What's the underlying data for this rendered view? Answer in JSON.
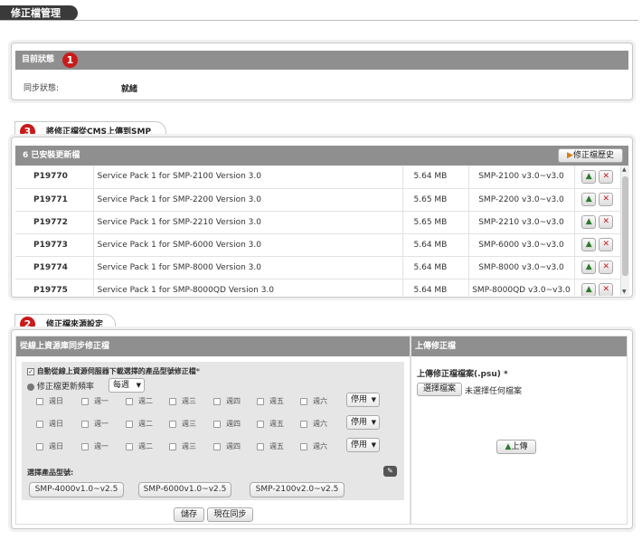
{
  "page": {
    "title": "修正檔管理"
  },
  "status_panel": {
    "header": "目前狀態",
    "badge": "1",
    "sync_label": "同步狀態:",
    "sync_value": "就緒"
  },
  "upload_panel": {
    "tab_badge": "3",
    "tab_label": "將修正檔從CMS上傳到SMP",
    "header": "6 已安裝更新檔",
    "history_button": "修正檔歷史",
    "rows": [
      {
        "id": "P19770",
        "desc": "Service Pack 1 for SMP-2100 Version 3.0",
        "size": "5.64 MB",
        "range": "SMP-2100 v3.0~v3.0"
      },
      {
        "id": "P19771",
        "desc": "Service Pack 1 for SMP-2200 Version 3.0",
        "size": "5.65 MB",
        "range": "SMP-2200 v3.0~v3.0"
      },
      {
        "id": "P19772",
        "desc": "Service Pack 1 for SMP-2210 Version 3.0",
        "size": "5.65 MB",
        "range": "SMP-2210 v3.0~v3.0"
      },
      {
        "id": "P19773",
        "desc": "Service Pack 1 for SMP-6000 Version 3.0",
        "size": "5.64 MB",
        "range": "SMP-6000 v3.0~v3.0"
      },
      {
        "id": "P19774",
        "desc": "Service Pack 1 for SMP-8000 Version 3.0",
        "size": "5.64 MB",
        "range": "SMP-8000 v3.0~v3.0"
      },
      {
        "id": "P19775",
        "desc": "Service Pack 1 for SMP-8000QD Version 3.0",
        "size": "5.64 MB",
        "range": "SMP-8000QD v3.0~v3.0"
      }
    ]
  },
  "source_panel": {
    "tab_badge": "2",
    "tab_label": "修正檔來源設定",
    "online_header": "從線上資源庫同步修正檔",
    "auto_download_label": "自動從線上資源伺服器下載選擇的產品型號修正檔",
    "auto_download_required": "*",
    "frequency_label": "修正檔更新頻率",
    "frequency_value": "每週",
    "days": [
      "週日",
      "週一",
      "週二",
      "週三",
      "週四",
      "週五",
      "週六"
    ],
    "schedule_state": "停用",
    "models_label": "選擇產品型號:",
    "models": [
      "SMP-4000v1.0~v2.5",
      "SMP-6000v1.0~v2.5",
      "SMP-2100v2.0~v2.5"
    ],
    "save_button": "儲存",
    "sync_now_button": "現在同步",
    "manual_header": "上傳修正檔",
    "file_label": "上傳修正檔檔案(.psu)",
    "file_required": "*",
    "choose_file_button": "選擇檔案",
    "no_file_text": "未選擇任何檔案",
    "upload_button": "上傳"
  },
  "colors": {
    "badge": "#c91b1b",
    "header_bar": "#8f8f8f",
    "delete_icon": "#c81e1e",
    "upload_icon": "#2d7a2d"
  }
}
